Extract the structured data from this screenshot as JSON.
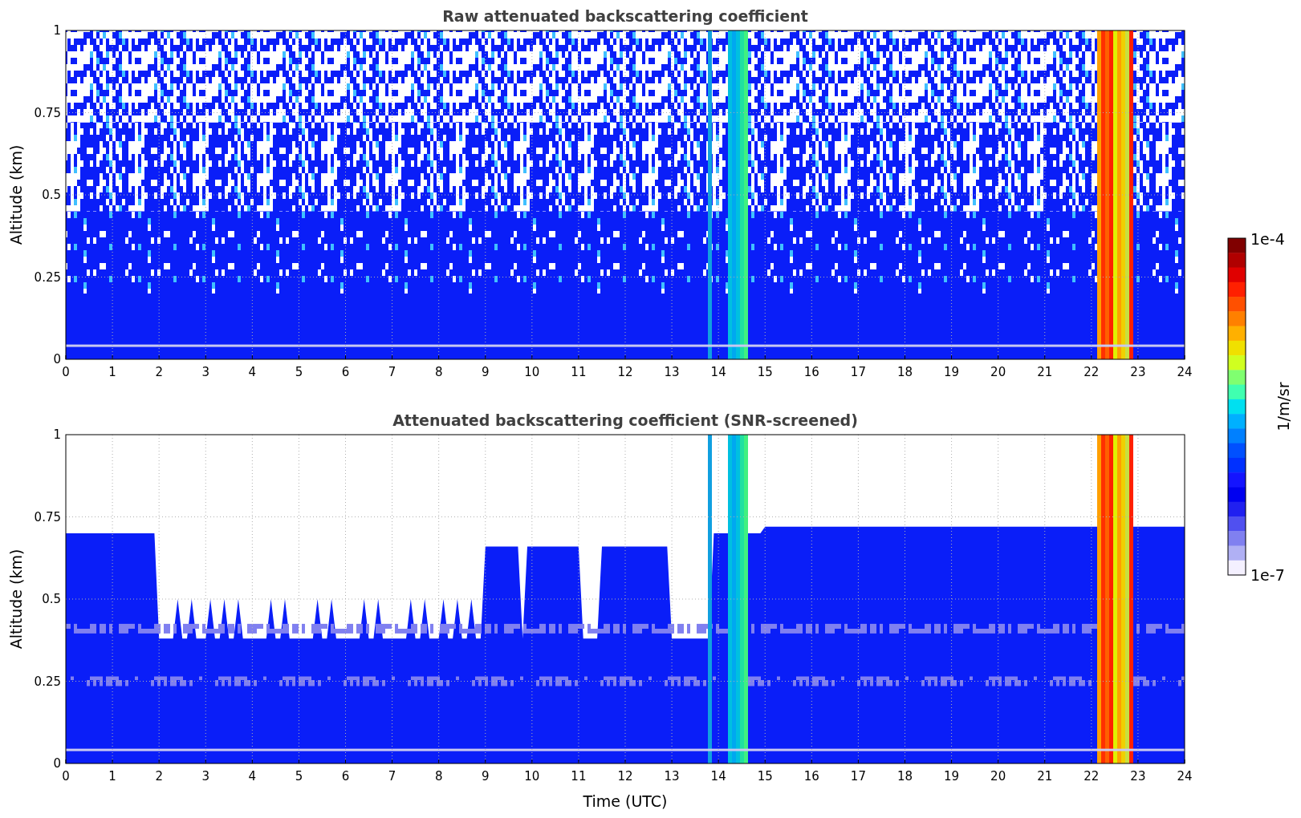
{
  "panels": [
    {
      "kind": "raw",
      "title": "Raw attenuated backscattering coefficient",
      "ylabel": "Altitude (km)",
      "yticks": [
        "1",
        "0.75",
        "0.5",
        "0.25",
        "0"
      ],
      "xticks": [
        "0",
        "1",
        "2",
        "3",
        "4",
        "5",
        "6",
        "7",
        "8",
        "9",
        "10",
        "11",
        "12",
        "13",
        "14",
        "15",
        "16",
        "17",
        "18",
        "19",
        "20",
        "21",
        "22",
        "23",
        "24"
      ]
    },
    {
      "kind": "screened",
      "title": "Attenuated backscattering coefficient (SNR-screened)",
      "ylabel": "Altitude (km)",
      "yticks": [
        "1",
        "0.75",
        "0.5",
        "0.25",
        "0"
      ],
      "xticks": [
        "0",
        "1",
        "2",
        "3",
        "4",
        "5",
        "6",
        "7",
        "8",
        "9",
        "10",
        "11",
        "12",
        "13",
        "14",
        "15",
        "16",
        "17",
        "18",
        "19",
        "20",
        "21",
        "22",
        "23",
        "24"
      ]
    }
  ],
  "xlabel": "Time (UTC)",
  "colorbar": {
    "label": "1/m/sr",
    "max_label": "1e-4",
    "min_label": "1e-7"
  }
}
